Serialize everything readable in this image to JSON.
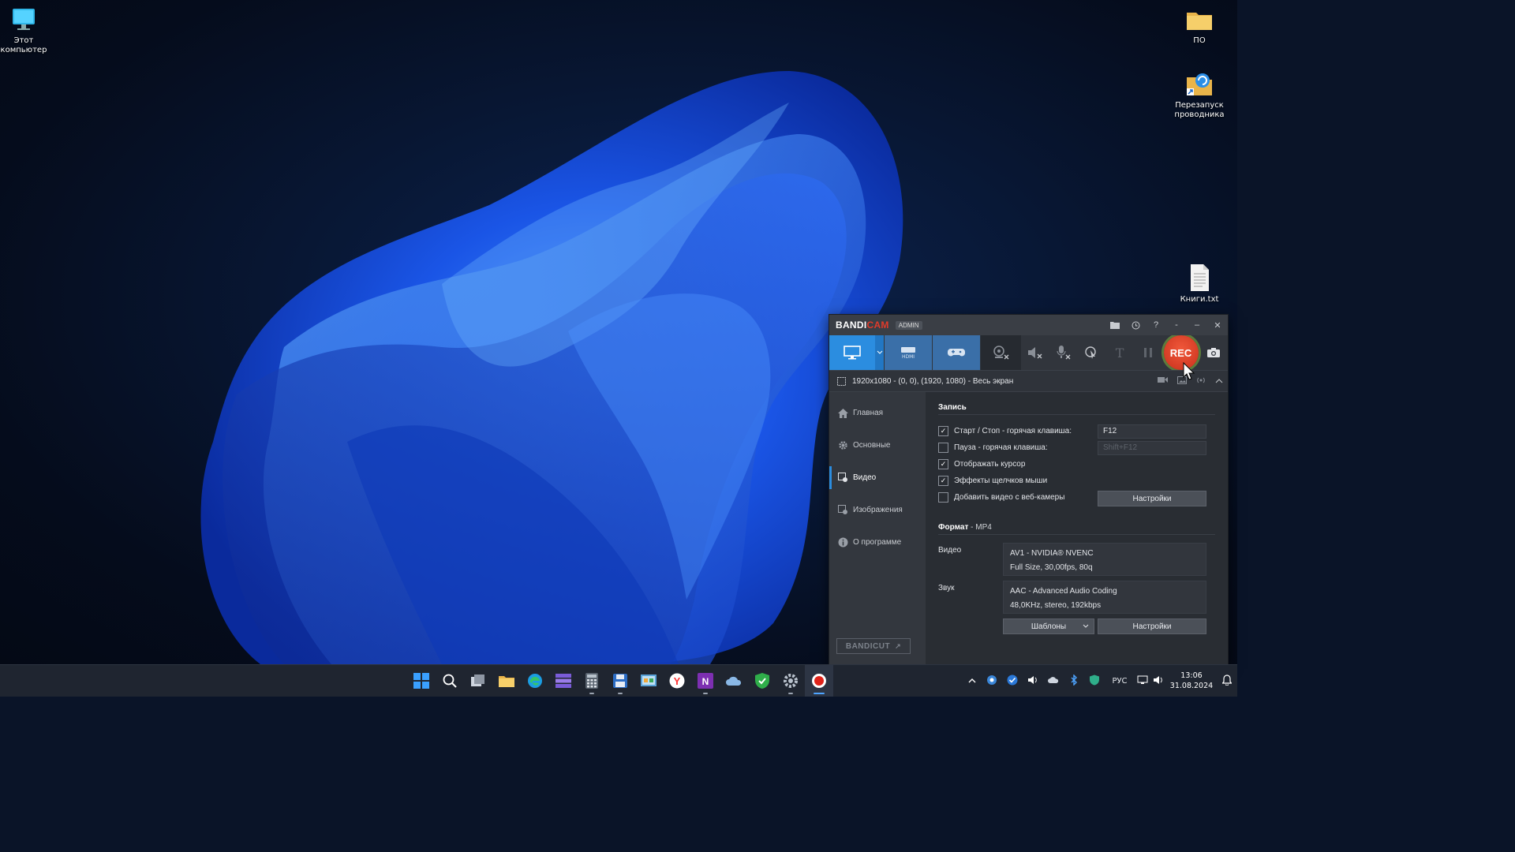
{
  "desktop": {
    "icons": [
      {
        "label_line1": "Этот",
        "label_line2": "компьютер",
        "icon": "computer-icon"
      },
      {
        "label_line1": "ПО",
        "label_line2": "",
        "icon": "folder-icon"
      },
      {
        "label_line1": "Перезапуск",
        "label_line2": "проводника",
        "icon": "shortcut-icon"
      },
      {
        "label_line1": "Книги.txt",
        "label_line2": "",
        "icon": "text-file-icon"
      }
    ]
  },
  "bandicam": {
    "logo_part1": "BANDI",
    "logo_part2": "CAM",
    "admin_badge": "ADMIN",
    "rec_label": "REC",
    "info_text": "1920x1080 - (0, 0), (1920, 1080) - Весь экран",
    "nav": [
      "Главная",
      "Основные",
      "Видео",
      "Изображения",
      "О программе"
    ],
    "active_nav": "Видео",
    "bandicut": "BANDICUT",
    "record_section": {
      "title": "Запись",
      "options": [
        {
          "label": "Старт / Стоп - горячая клавиша:",
          "checked": true,
          "value": "F12"
        },
        {
          "label": "Пауза - горячая клавиша:",
          "checked": false,
          "value": "Shift+F12"
        },
        {
          "label": "Отображать курсор",
          "checked": true
        },
        {
          "label": "Эффекты щелчков мыши",
          "checked": true
        },
        {
          "label": "Добавить видео с веб-камеры",
          "checked": false
        }
      ],
      "settings_button": "Настройки"
    },
    "format_section": {
      "title": "Формат",
      "format_value": " - MP4",
      "video_label": "Видео",
      "video_line1": "AV1 - NVIDIA® NVENC",
      "video_line2": "Full Size, 30,00fps, 80q",
      "audio_label": "Звук",
      "audio_line1": "AAC - Advanced Audio Coding",
      "audio_line2": "48,0KHz, stereo, 192kbps",
      "templates_button": "Шаблоны",
      "settings_button": "Настройки"
    }
  },
  "taskbar": {
    "lang": "РУС",
    "time": "13:06",
    "date": "31.08.2024"
  },
  "colors": {
    "accent_blue": "#2b8de0",
    "rec_red": "#e0452a",
    "logo_red": "#e03a2a"
  }
}
